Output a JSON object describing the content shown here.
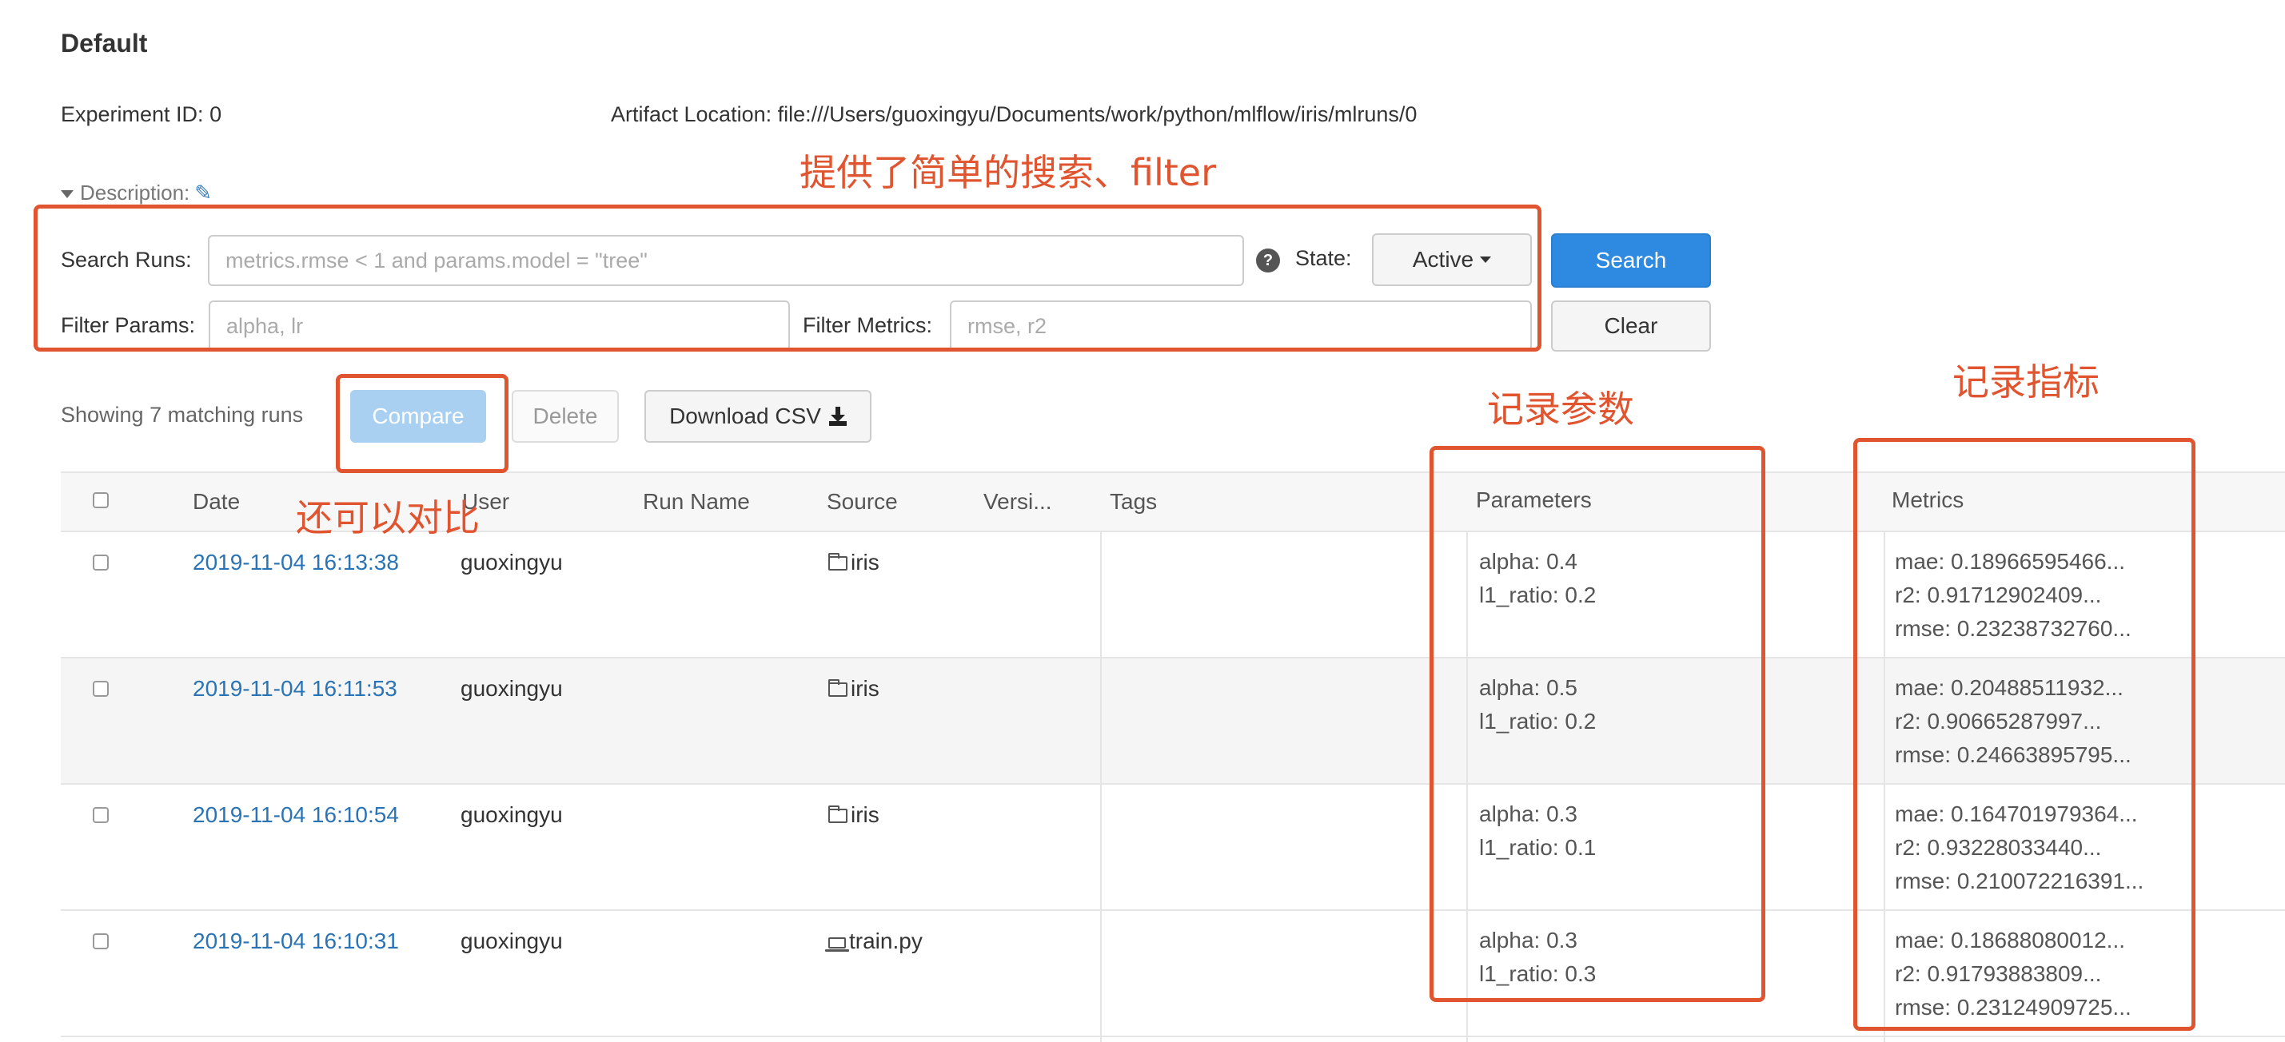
{
  "experiment": {
    "name": "Default",
    "id_label": "Experiment ID:",
    "id_value": "0",
    "artifact_label": "Artifact Location:",
    "artifact_value": "file:///Users/guoxingyu/Documents/work/python/mlflow/iris/mlruns/0",
    "description_label": "Description:"
  },
  "search": {
    "runs_label": "Search Runs:",
    "runs_placeholder": "metrics.rmse < 1 and params.model = \"tree\"",
    "help": "?",
    "state_label": "State:",
    "state_value": "Active",
    "search_button": "Search",
    "clear_button": "Clear",
    "params_label": "Filter Params:",
    "params_placeholder": "alpha, lr",
    "metrics_label": "Filter Metrics:",
    "metrics_placeholder": "rmse, r2"
  },
  "actions": {
    "showing": "Showing 7 matching runs",
    "compare": "Compare",
    "delete": "Delete",
    "download": "Download CSV"
  },
  "table": {
    "headers": {
      "date": "Date",
      "user": "User",
      "run_name": "Run Name",
      "source": "Source",
      "version": "Versi...",
      "tags": "Tags",
      "parameters": "Parameters",
      "metrics": "Metrics"
    },
    "rows": [
      {
        "date": "2019-11-04 16:13:38",
        "user": "guoxingyu",
        "source": "iris",
        "source_icon": "folder-icon",
        "params": [
          "alpha: 0.4",
          "l1_ratio: 0.2"
        ],
        "metrics": [
          "mae: 0.18966595466...",
          "r2: 0.91712902409...",
          "rmse: 0.23238732760..."
        ]
      },
      {
        "date": "2019-11-04 16:11:53",
        "user": "guoxingyu",
        "source": "iris",
        "source_icon": "folder-icon",
        "params": [
          "alpha: 0.5",
          "l1_ratio: 0.2"
        ],
        "metrics": [
          "mae: 0.20488511932...",
          "r2: 0.90665287997...",
          "rmse: 0.24663895795..."
        ]
      },
      {
        "date": "2019-11-04 16:10:54",
        "user": "guoxingyu",
        "source": "iris",
        "source_icon": "folder-icon",
        "params": [
          "alpha: 0.3",
          "l1_ratio: 0.1"
        ],
        "metrics": [
          "mae: 0.164701979364...",
          "r2: 0.93228033440...",
          "rmse: 0.210072216391..."
        ]
      },
      {
        "date": "2019-11-04 16:10:31",
        "user": "guoxingyu",
        "source": "train.py",
        "source_icon": "laptop-icon",
        "params": [
          "alpha: 0.3",
          "l1_ratio: 0.3"
        ],
        "metrics": [
          "mae: 0.18688080012...",
          "r2: 0.91793883809...",
          "rmse: 0.23124909725..."
        ]
      }
    ]
  },
  "annotations": {
    "search_note": "提供了简单的搜索、filter",
    "compare_note": "还可以对比",
    "params_note": "记录参数",
    "metrics_note": "记录指标"
  },
  "colors": {
    "accent": "#2d8ae0",
    "link": "#2a74b5",
    "annotation": "#e0552f"
  }
}
